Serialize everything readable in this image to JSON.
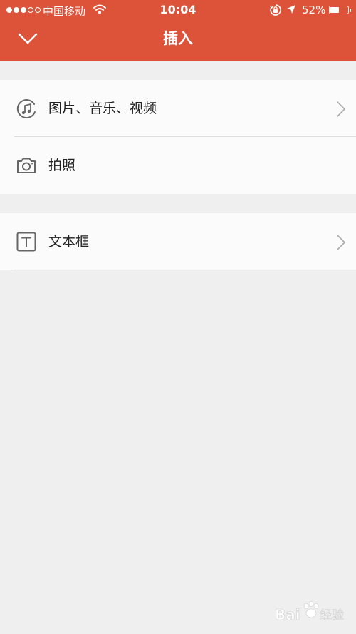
{
  "status_bar": {
    "carrier": "中国移动",
    "time": "10:04",
    "battery_percent": "52%",
    "battery_level": 0.52
  },
  "nav": {
    "title": "插入",
    "back_icon": "chevron-down-icon"
  },
  "sections": [
    {
      "items": [
        {
          "label": "图片、音乐、视频",
          "icon": "media-music-icon",
          "has_arrow": true
        },
        {
          "label": "拍照",
          "icon": "camera-icon",
          "has_arrow": false
        }
      ]
    },
    {
      "items": [
        {
          "label": "文本框",
          "icon": "textbox-icon",
          "has_arrow": true
        }
      ]
    }
  ],
  "watermark": {
    "text": "Bai 经验"
  },
  "colors": {
    "accent": "#dc5339",
    "background": "#efefef",
    "row_background": "#fbfbfb"
  }
}
